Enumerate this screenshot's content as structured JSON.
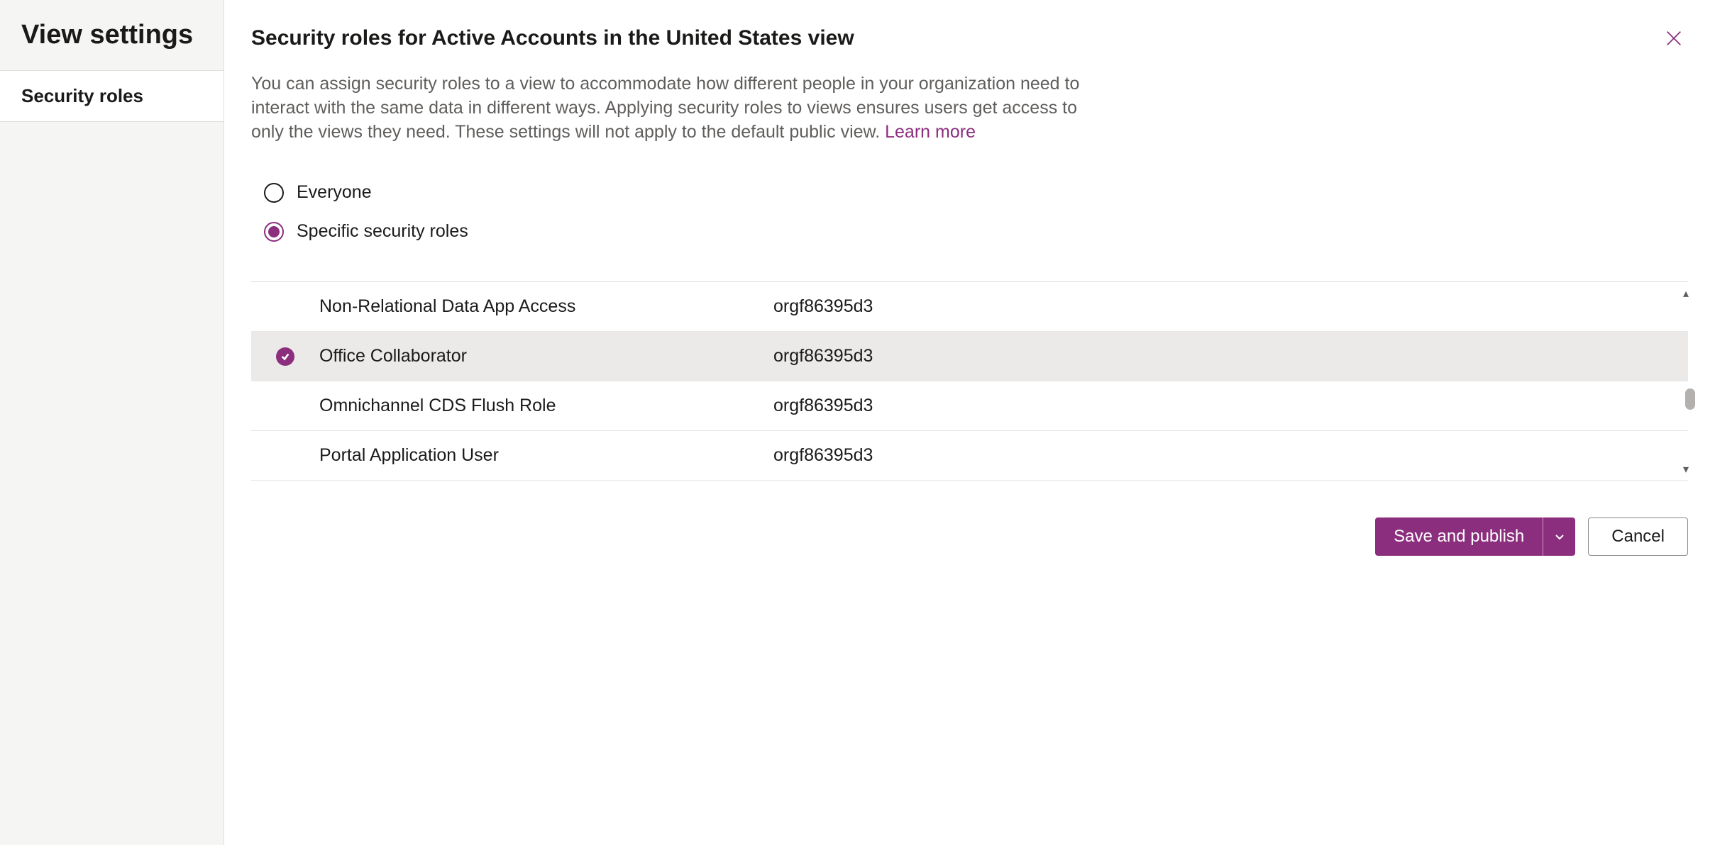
{
  "sidebar": {
    "title": "View settings",
    "active_item": "Security roles"
  },
  "header": {
    "title": "Security roles for Active Accounts in the United States view"
  },
  "description": {
    "text": "You can assign security roles to a view to accommodate how different people in your organization need to interact with the same data in different ways. Applying security roles to views ensures users get access to only the views they need. These settings will not apply to the default public view. ",
    "learn_more": "Learn more"
  },
  "radio": {
    "everyone": "Everyone",
    "specific": "Specific security roles",
    "selected": "specific"
  },
  "table": {
    "rows": [
      {
        "name": "Non-Relational Data App Access",
        "org": "orgf86395d3",
        "selected": false
      },
      {
        "name": "Office Collaborator",
        "org": "orgf86395d3",
        "selected": true
      },
      {
        "name": "Omnichannel CDS Flush Role",
        "org": "orgf86395d3",
        "selected": false
      },
      {
        "name": "Portal Application User",
        "org": "orgf86395d3",
        "selected": false
      }
    ]
  },
  "footer": {
    "save": "Save and publish",
    "cancel": "Cancel"
  }
}
